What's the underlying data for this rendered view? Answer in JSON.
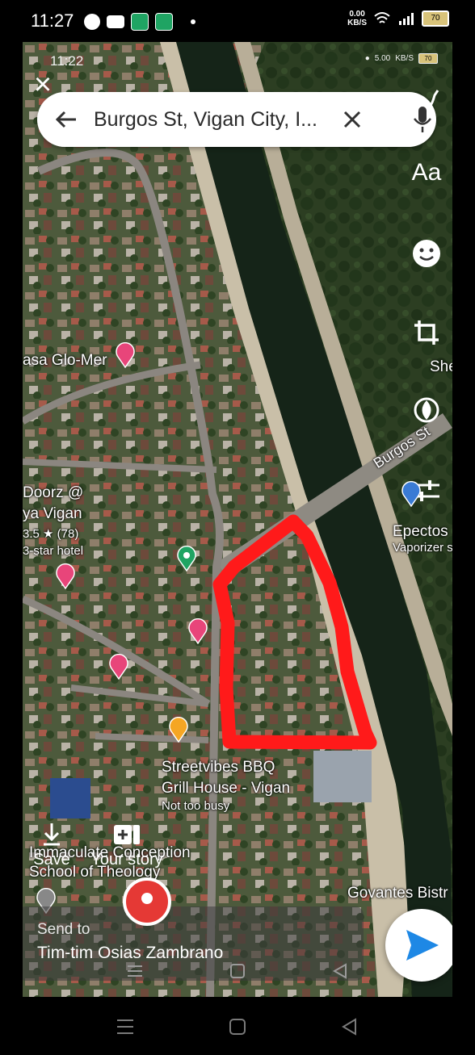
{
  "status": {
    "time": "11:27",
    "net_speed": "0.00",
    "net_unit": "KB/S",
    "battery": "70"
  },
  "inner_status": {
    "time": "11:22",
    "net_speed": "5.00",
    "net_unit": "KB/S",
    "battery": "70"
  },
  "search": {
    "query": "Burgos St, Vigan City, I..."
  },
  "tools": {
    "text_tool": "Aa"
  },
  "map_labels": {
    "casa": "asa Glo-Mer",
    "doorz1": "Doorz @",
    "doorz2": "ya Vigan",
    "doorz_rating": "3.5 ★ (78)",
    "doorz_type": "3-star hotel",
    "burgos": "Burgos St",
    "shel": "She",
    "epectos": "Epectos",
    "vaporizer": "Vaporizer s",
    "streetvibes1": "Streetvibes BBQ",
    "streetvibes2": "Grill House - Vigan",
    "busy": "Not too busy",
    "immaculate1": "Immaculate Conception",
    "immaculate2": "School of Theology",
    "govantes": "Govantes Bistr"
  },
  "actions": {
    "save": "Save",
    "your_story": "Your story"
  },
  "send": {
    "label": "Send to",
    "recipient": "Tim-tim Osias Zambrano"
  },
  "colors": {
    "highlight": "#ff1a1a",
    "send_arrow": "#1e88e5",
    "pin_hotel": "#e8457a",
    "pin_food": "#f5a623",
    "pin_green": "#1fa463"
  }
}
